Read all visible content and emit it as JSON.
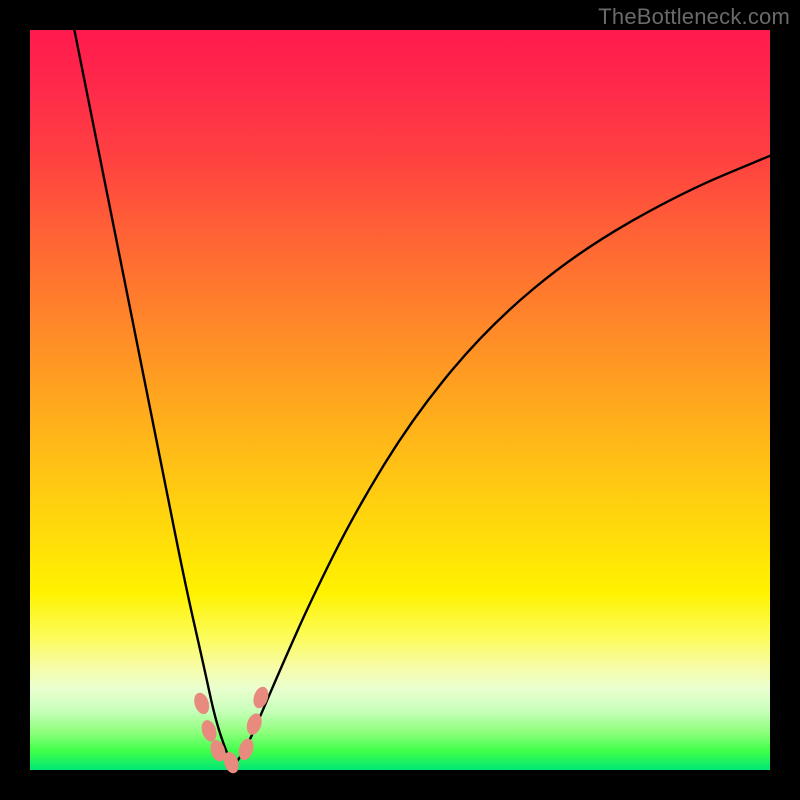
{
  "watermark": "TheBottleneck.com",
  "colors": {
    "frame": "#000000",
    "watermark": "#6a6a6a",
    "curve": "#000000",
    "marker": "#e88a7d",
    "gradient_top": "#ff1a4d",
    "gradient_bottom": "#00e676"
  },
  "chart_data": {
    "type": "line",
    "title": "",
    "xlabel": "",
    "ylabel": "",
    "xlim": [
      0,
      100
    ],
    "ylim": [
      0,
      100
    ],
    "grid": false,
    "legend": false,
    "description": "Bottleneck-style V-curve on a red→green vertical gradient background. Minimum (optimal point) near x≈27, y≈0. Left branch rises steeply toward top-left; right branch rises more gradually toward upper-right. Salmon markers cluster around the trough.",
    "series": [
      {
        "name": "left-branch",
        "x": [
          6,
          10,
          14,
          18,
          21,
          23.5,
          25,
          26.5,
          27.5
        ],
        "y": [
          100,
          80,
          60,
          40,
          25,
          14,
          7,
          2.5,
          0.5
        ]
      },
      {
        "name": "right-branch",
        "x": [
          27.5,
          29,
          31,
          34,
          38,
          44,
          52,
          62,
          74,
          88,
          100
        ],
        "y": [
          0.5,
          2.5,
          7,
          14,
          23,
          35,
          48,
          60,
          70,
          78,
          83
        ]
      }
    ],
    "markers": {
      "name": "optimal-cluster",
      "points": [
        {
          "x": 23.2,
          "y": 9.0
        },
        {
          "x": 24.2,
          "y": 5.3
        },
        {
          "x": 25.4,
          "y": 2.6
        },
        {
          "x": 27.2,
          "y": 1.0
        },
        {
          "x": 29.2,
          "y": 2.8
        },
        {
          "x": 30.3,
          "y": 6.2
        },
        {
          "x": 31.2,
          "y": 9.8
        }
      ]
    }
  }
}
